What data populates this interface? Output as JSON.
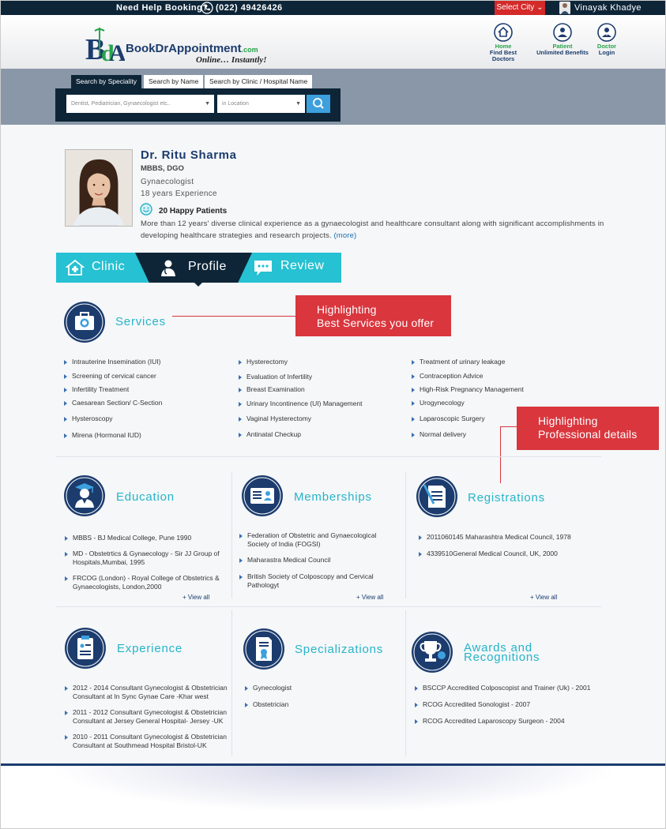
{
  "topbar": {
    "help_text": "Need Help Booking?",
    "phone": "(022) 49426426",
    "city_label": "Select City",
    "user_name": "Vinayak Khadye"
  },
  "brand": {
    "name": "BookDrAppointment",
    "domain_suffix": ".com",
    "tagline": "Online… Instantly!",
    "colors": {
      "navy": "#1c3c6e",
      "green": "#27a44a",
      "teal": "#26c1d2",
      "red": "#d9363e",
      "topbar": "#0e2538"
    }
  },
  "nav": [
    {
      "line1": "Home",
      "line2": "Find Best Doctors",
      "icon": "home-icon"
    },
    {
      "line1": "Patient",
      "line2": "Unlimited Benefits",
      "icon": "patient-icon"
    },
    {
      "line1": "Doctor",
      "line2": "Login",
      "icon": "doctor-icon"
    }
  ],
  "search": {
    "tabs": [
      "Search by Speciality",
      "Search by Name",
      "Search by Clinic / Hospital Name"
    ],
    "speciality_placeholder": "Dentist, Pediatrician, Gynaecologist etc..",
    "location_placeholder": "in Location"
  },
  "doctor": {
    "name": "Dr. Ritu Sharma",
    "degree": "MBBS, DGO",
    "speciality": "Gynaecologist",
    "experience": "18 years Experience",
    "happy_patients": "20 Happy Patients",
    "bio": "More than 12 years' diverse clinical experience as a gynaecologist and healthcare consultant along with significant accomplishments in developing healthcare strategies and research projects.",
    "more_link": "(more)"
  },
  "profile_tabs": [
    {
      "label": "Clinic",
      "icon": "clinic-icon"
    },
    {
      "label": "Profile",
      "icon": "doctor-profile-icon"
    },
    {
      "label": "Review",
      "icon": "review-icon"
    }
  ],
  "services": {
    "title": "Services",
    "col1": [
      "Intrauterine Insemination (IUI)",
      "Screening of cervical cancer",
      "Infertility Treatment",
      "Caesarean Section/ C-Section",
      "Hysteroscopy",
      "Mirena (Hormonal IUD)"
    ],
    "col2": [
      "Hysterectomy",
      "Evaluation of Infertility",
      "Breast Examination",
      "Urinary Incontinence (UI) Management",
      "Vaginal Hysterectomy",
      "Antinatal Checkup"
    ],
    "col3": [
      "Treatment of urinary leakage",
      "Contraception Advice",
      "High-Risk Pregnancy Management",
      "Urogynecology",
      "Laparoscopic Surgery",
      "Normal delivery"
    ]
  },
  "callouts": {
    "services": {
      "line1": "Highlighting",
      "line2": "Best Services you offer"
    },
    "professional": {
      "line1": "Highlighting",
      "line2": "Professional details"
    }
  },
  "education": {
    "title": "Education",
    "items": [
      "MBBS - BJ Medical College, Pune 1990",
      "MD - Obstetrtics & Gynaecology - Sir JJ Group of Hospitals,Mumbai, 1995",
      "FRCOG (London) - Royal College of Obstetrics & Gynaecologists, London,2000"
    ],
    "view_all": "+ View all"
  },
  "memberships": {
    "title": "Memberships",
    "items": [
      "Federation of Obstetric and Gynaecological Society of India (FOGSI)",
      "Maharastra Medical Council",
      "British Society of Colposcopy and Cervical Pathologyt"
    ],
    "view_all": "+ View all"
  },
  "registrations": {
    "title": "Registrations",
    "items": [
      "2011060145 Maharashtra Medical Council, 1978",
      "4339510General Medical Council, UK, 2000"
    ],
    "view_all": "+ View all"
  },
  "experience": {
    "title": "Experience",
    "items": [
      "2012 - 2014 Consultant Gynecologist & Obstetrician Consultant at In Sync Gynae Care -Khar west",
      "2011 - 2012 Consultant Gynecologist & Obstetrician Consultant at Jersey General Hospital- Jersey -UK",
      "2010 - 2011 Consultant Gynecologist & Obstetrician Consultant at Southmead Hospital Bristol-UK"
    ]
  },
  "specializations": {
    "title": "Specializations",
    "items": [
      "Gynecologist",
      "Obstetrician"
    ]
  },
  "awards": {
    "title_line1": "Awards and",
    "title_line2": "Recognitions",
    "items": [
      "BSCCP Accredited Colposcopist and Trainer (Uk) - 2001",
      "RCOG Accredited Sonologist - 2007",
      "RCOG Accredited Laparoscopy Surgeon - 2004"
    ]
  }
}
